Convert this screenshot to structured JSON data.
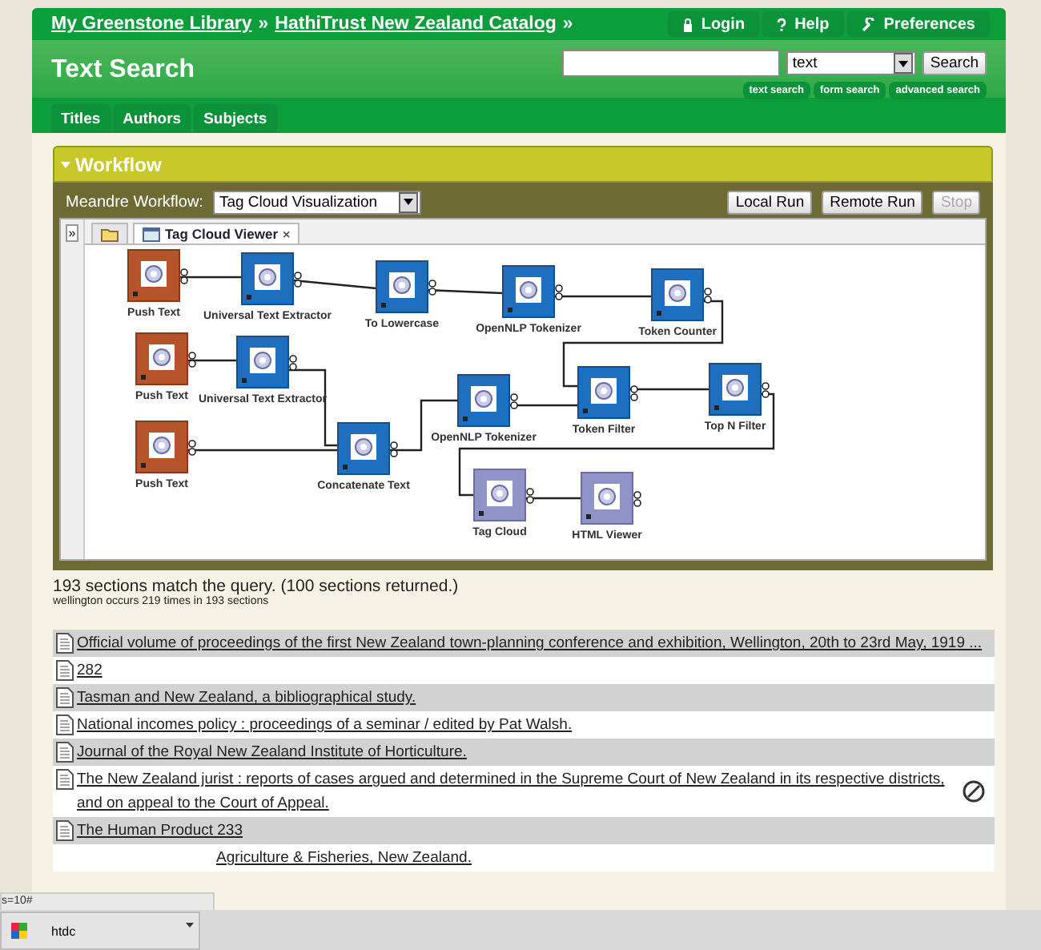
{
  "breadcrumb": {
    "links": [
      "My Greenstone Library",
      "HathiTrust New Zealand Catalog"
    ],
    "separator": "»"
  },
  "nav_buttons": [
    {
      "label": "Login",
      "kind": "lock"
    },
    {
      "label": "Help",
      "kind": "help"
    },
    {
      "label": "Preferences",
      "kind": "wrench"
    }
  ],
  "page_title": "Text Search",
  "search": {
    "scope": "text",
    "button": "Search",
    "links": [
      "text search",
      "form search",
      "advanced search"
    ]
  },
  "tabs": [
    "Titles",
    "Authors",
    "Subjects"
  ],
  "workflow": {
    "title": "Workflow",
    "expanded": true,
    "label": "Meandre Workflow:",
    "selection": "Tag Cloud Visualization",
    "buttons": [
      {
        "label": "Local Run",
        "disabled": false
      },
      {
        "label": "Remote Run",
        "disabled": false
      },
      {
        "label": "Stop",
        "disabled": true
      }
    ],
    "collapse_button": "»",
    "canvas_tabs": [
      {
        "kind": "folder",
        "selected": false
      },
      {
        "kind": "viewer",
        "label": "Tag Cloud Viewer",
        "selected": true,
        "close": "×"
      }
    ],
    "nodes": [
      {
        "label": "Push Text",
        "kind": "input"
      },
      {
        "label": "Universal Text Extractor",
        "kind": "process"
      },
      {
        "label": "To Lowercase",
        "kind": "process"
      },
      {
        "label": "OpenNLP Tokenizer",
        "kind": "process"
      },
      {
        "label": "Token Counter",
        "kind": "process"
      },
      {
        "label": "Push Text",
        "kind": "input"
      },
      {
        "label": "Universal Text Extractor",
        "kind": "process"
      },
      {
        "label": "Concatenate Text",
        "kind": "process"
      },
      {
        "label": "OpenNLP Tokenizer",
        "kind": "process"
      },
      {
        "label": "Token Filter",
        "kind": "process"
      },
      {
        "label": "Top N Filter",
        "kind": "process"
      },
      {
        "label": "Push Text",
        "kind": "input"
      },
      {
        "label": "Tag Cloud",
        "kind": "output"
      },
      {
        "label": "HTML Viewer",
        "kind": "output"
      }
    ]
  },
  "results": {
    "summary": "193 sections match the query. (100 sections returned.)",
    "detail": "wellington occurs 219 times in 193 sections",
    "rows": [
      {
        "title": "Official volume of proceedings of the first New Zealand town-planning conference and exhibition, Wellington, 20th to 23rd May, 1919 ...",
        "kind": "normal"
      },
      {
        "title": "282",
        "kind": "normal"
      },
      {
        "title": "Tasman and New Zealand, a bibliographical study.",
        "kind": "normal"
      },
      {
        "title": "National incomes policy : proceedings of a seminar / edited by Pat Walsh.",
        "kind": "normal"
      },
      {
        "title": "Journal of the Royal New Zealand Institute of Horticulture.",
        "kind": "normal"
      },
      {
        "title": "The New Zealand jurist : reports of cases argued and determined in the Supreme Court of New Zealand in its respective districts, and on appeal to the Court of Appeal.",
        "kind": "marked"
      },
      {
        "title": "The Human Product 233",
        "kind": "normal"
      },
      {
        "title": "Agriculture & Fisheries, New Zealand.",
        "kind": "covered"
      }
    ]
  },
  "status_tooltip": "s=10#",
  "taskbar": {
    "items": [
      {
        "label": "htdc"
      }
    ]
  }
}
